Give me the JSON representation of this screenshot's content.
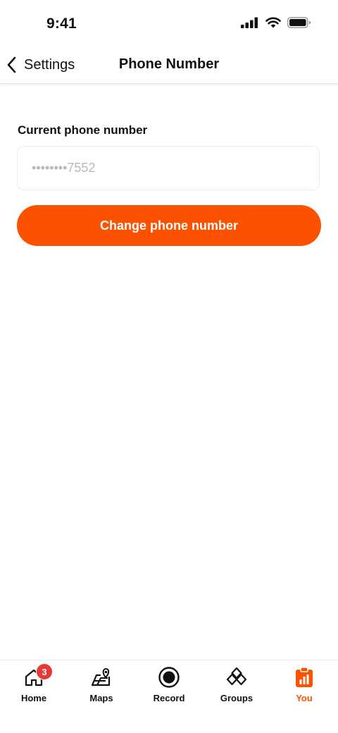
{
  "status_bar": {
    "time": "9:41"
  },
  "header": {
    "back_label": "Settings",
    "title": "Phone Number"
  },
  "phone": {
    "label": "Current phone number",
    "placeholder": "••••••••7552"
  },
  "actions": {
    "change_label": "Change phone number"
  },
  "tabs": [
    {
      "label": "Home",
      "icon": "home-icon",
      "badge": "3"
    },
    {
      "label": "Maps",
      "icon": "maps-icon"
    },
    {
      "label": "Record",
      "icon": "record-icon"
    },
    {
      "label": "Groups",
      "icon": "groups-icon"
    },
    {
      "label": "You",
      "icon": "you-icon",
      "active": true
    }
  ],
  "colors": {
    "accent": "#fc5200",
    "badge": "#e53935",
    "text": "#111111",
    "placeholder": "#b9b9b9"
  }
}
